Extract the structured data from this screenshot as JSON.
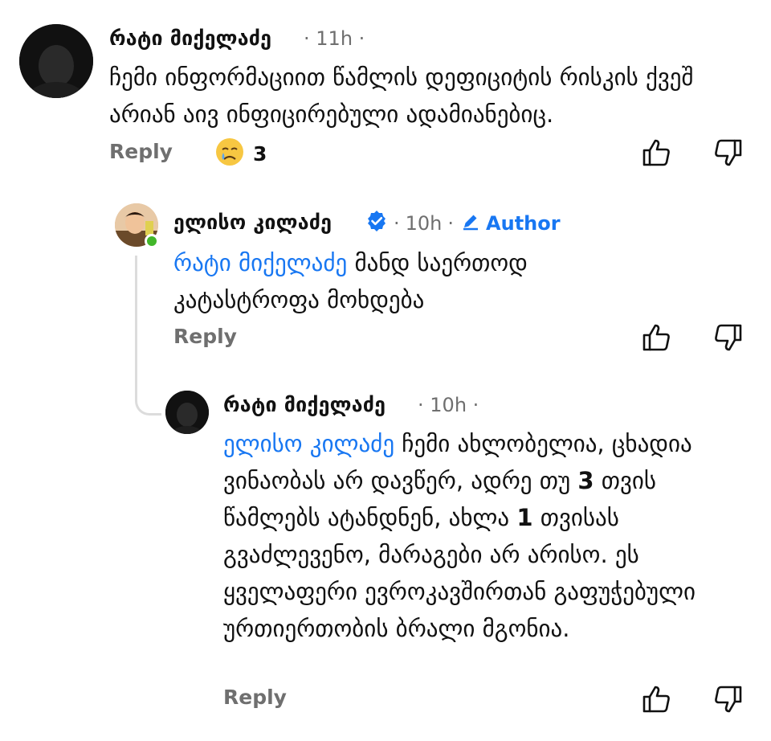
{
  "comments": [
    {
      "author": "რატი მიქელაძე",
      "time": "11h",
      "sep": "·",
      "text": "ჩემი ინფორმაციით წამლის დეფიციტის რისკის ქვეშ არიან აივ ინფიცირებული ადამიანებიც.",
      "reply_label": "Reply",
      "reaction_count": "3",
      "reaction_icon": "crying-face"
    },
    {
      "author": "ელისო კილაძე",
      "verified": true,
      "time": "10h",
      "sep": "·",
      "author_badge": "Author",
      "mention": "რატი მიქელაძე",
      "text": "მანდ საერთოდ კატასტროფა მოხდება",
      "reply_label": "Reply"
    },
    {
      "author": "რატი მიქელაძე",
      "time": "10h",
      "sep": "·",
      "mention": "ელისო კილაძე",
      "text_parts": [
        "ჩემი ახლობელია, ცხადია ვინაობას არ დავწერ, ადრე თუ ",
        "3",
        " თვის წამლებს ატანდნენ, ახლა ",
        "1",
        " თვისას გვაძლევენო, მარაგები არ არისო. ეს ყველაფერი ევროკავშირთან გაფუჭებული ურთიერთობის ბრალი მგონია."
      ],
      "reply_label": "Reply"
    }
  ],
  "colors": {
    "mention": "#1877f2",
    "meta": "#6f6f6f",
    "online": "#42b72a",
    "thread_line": "#dcdcdc"
  }
}
